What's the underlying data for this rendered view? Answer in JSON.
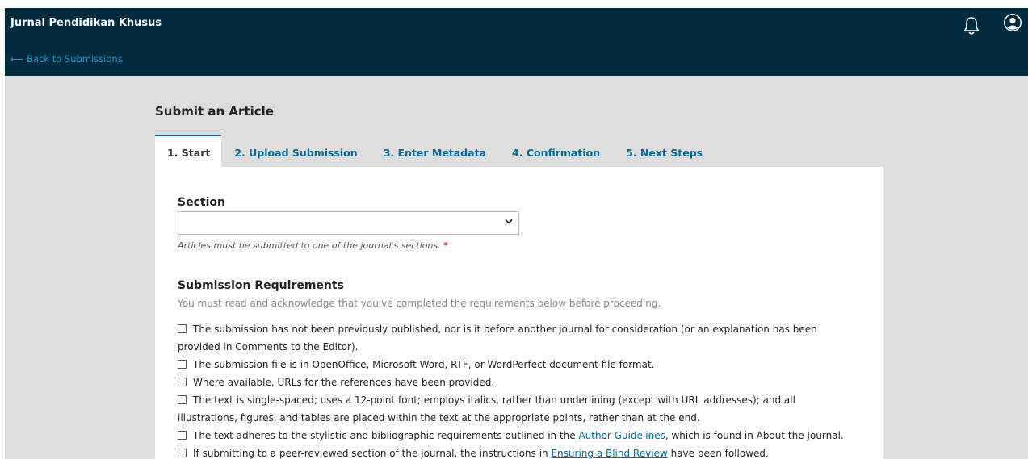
{
  "header": {
    "app_title": "Jurnal Pendidikan Khusus",
    "back_link": "⟵ Back to Submissions"
  },
  "page": {
    "title": "Submit an Article"
  },
  "tabs": [
    {
      "label": "1. Start"
    },
    {
      "label": "2. Upload Submission"
    },
    {
      "label": "3. Enter Metadata"
    },
    {
      "label": "4. Confirmation"
    },
    {
      "label": "5. Next Steps"
    }
  ],
  "section": {
    "label": "Section",
    "selected_value": "",
    "help": "Articles must be submitted to one of the journal's sections.",
    "required_mark": "*"
  },
  "requirements": {
    "title": "Submission Requirements",
    "description": "You must read and acknowledge that you've completed the requirements below before proceeding.",
    "items": [
      {
        "text": "The submission has not been previously published, nor is it before another journal for consideration (or an explanation has been provided in Comments to the Editor)."
      },
      {
        "text": "The submission file is in OpenOffice, Microsoft Word, RTF, or WordPerfect document file format."
      },
      {
        "text": "Where available, URLs for the references have been provided."
      },
      {
        "text": "The text is single-spaced; uses a 12-point font; employs italics, rather than underlining (except with URL addresses); and all illustrations, figures, and tables are placed within the text at the appropriate points, rather than at the end."
      },
      {
        "before": "The text adheres to the stylistic and bibliographic requirements outlined in the ",
        "link": "Author Guidelines",
        "after": ", which is found in About the Journal."
      },
      {
        "before": "If submitting to a peer-reviewed section of the journal, the instructions in ",
        "link": "Ensuring a Blind Review",
        "after": " have been followed."
      }
    ]
  },
  "colors": {
    "header_bg": "#002c3e",
    "accent": "#006798",
    "link_light": "#1e98d4",
    "required": "#d00a6c",
    "page_bg": "#dddddd"
  },
  "icons": {
    "notifications": "bell-icon",
    "user": "user-circle-icon",
    "select_arrow": "chevron-down-icon"
  }
}
